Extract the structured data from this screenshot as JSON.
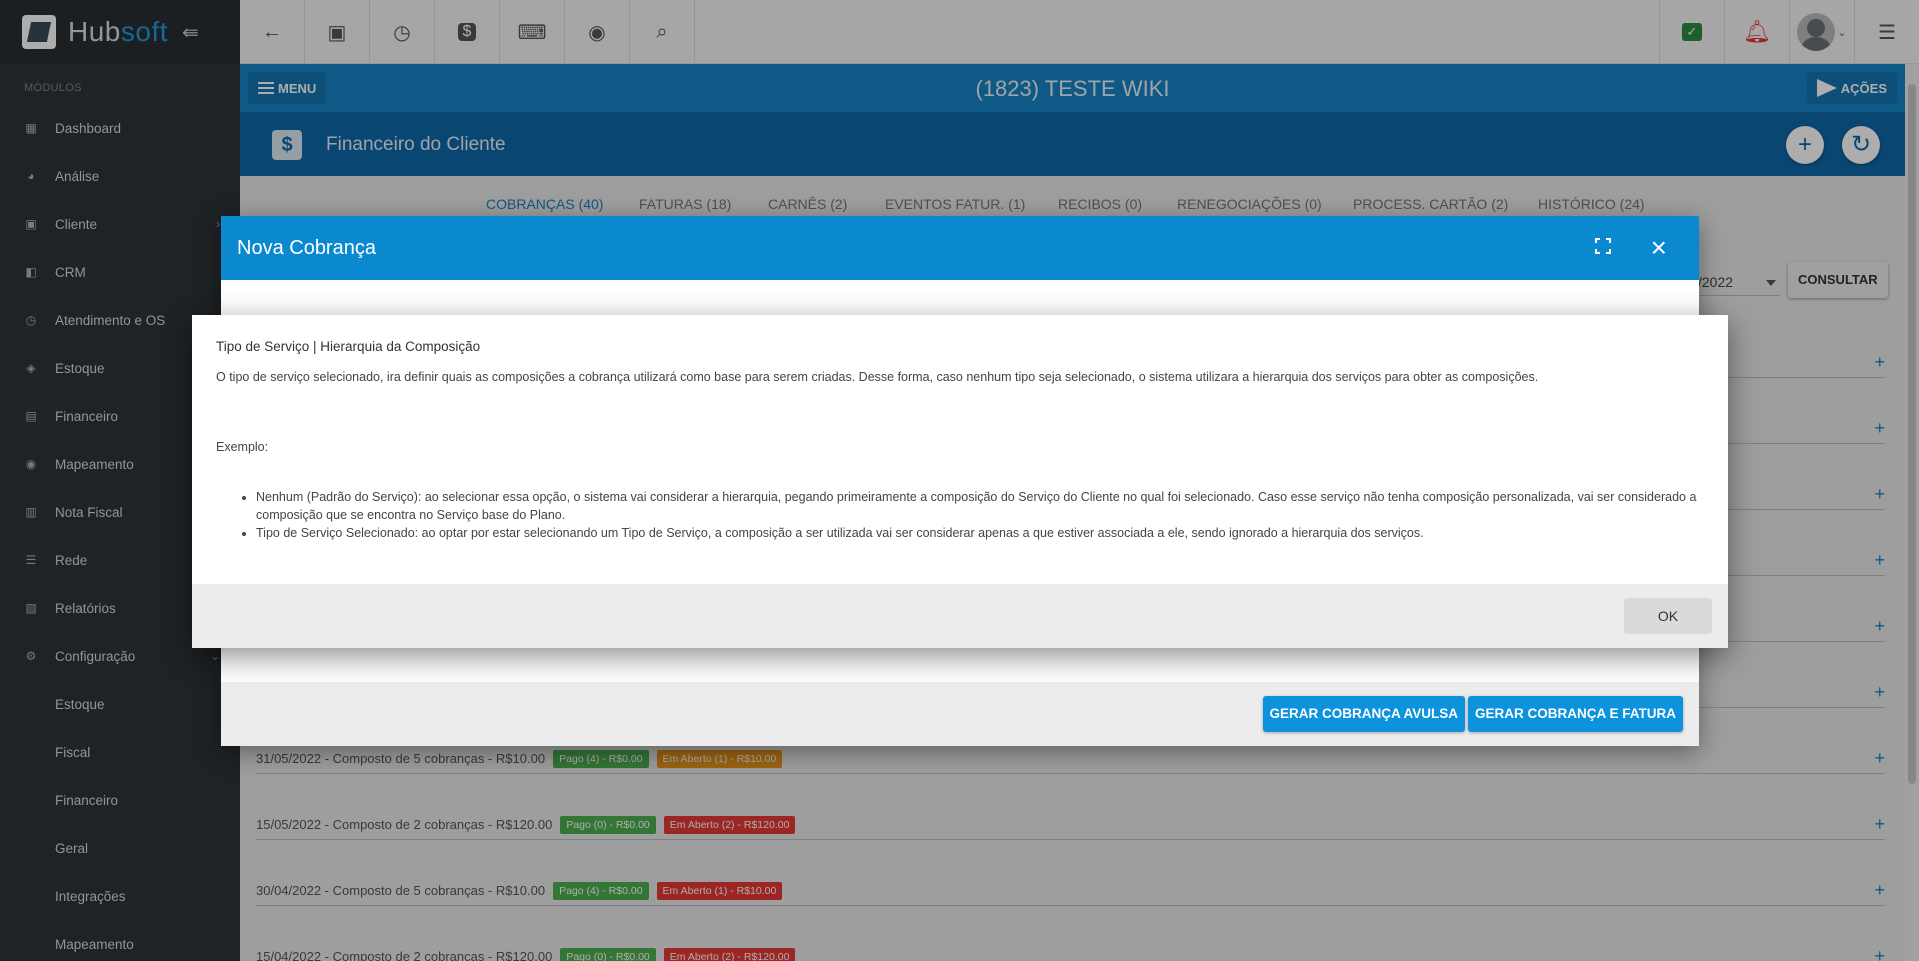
{
  "brand": {
    "name_part1": "Hub",
    "name_part2": "soft"
  },
  "sidebar": {
    "modules_label": "MÓDULOS",
    "items": [
      {
        "label": "Dashboard"
      },
      {
        "label": "Análise"
      },
      {
        "label": "Cliente"
      },
      {
        "label": "CRM"
      },
      {
        "label": "Atendimento e OS"
      },
      {
        "label": "Estoque"
      },
      {
        "label": "Financeiro"
      },
      {
        "label": "Mapeamento"
      },
      {
        "label": "Nota Fiscal"
      },
      {
        "label": "Rede"
      },
      {
        "label": "Relatórios"
      },
      {
        "label": "Configuração"
      }
    ],
    "subitems": [
      {
        "label": "Estoque"
      },
      {
        "label": "Fiscal"
      },
      {
        "label": "Financeiro"
      },
      {
        "label": "Geral"
      },
      {
        "label": "Integrações"
      },
      {
        "label": "Mapeamento"
      }
    ]
  },
  "client_bar": {
    "menu_label": "MENU",
    "title": "(1823) TESTE WIKI",
    "actions_label": "AÇÕES"
  },
  "section": {
    "title": "Financeiro do Cliente",
    "icon": "$"
  },
  "tabs": [
    {
      "label": "COBRANÇAS (40)"
    },
    {
      "label": "FATURAS (18)"
    },
    {
      "label": "CARNÊS (2)"
    },
    {
      "label": "EVENTOS FATUR. (1)"
    },
    {
      "label": "RECIBOS (0)"
    },
    {
      "label": "RENEGOCIAÇÕES (0)"
    },
    {
      "label": "PROCESS. CARTÃO (2)"
    },
    {
      "label": "HISTÓRICO (24)"
    }
  ],
  "filters": {
    "date_value": "/2022",
    "consult_label": "CONSULTAR"
  },
  "rows": [
    {
      "text": "31/05/2022 - Composto de 5 cobranças - R$10.00",
      "paid": "Pago (4) - R$0.00",
      "open": "Em Aberto (1) - R$10.00"
    },
    {
      "text": "15/05/2022 - Composto de 2 cobranças - R$120.00",
      "paid": "Pago (0) - R$0.00",
      "open": "Em Aberto (2) - R$120.00"
    },
    {
      "text": "30/04/2022 - Composto de 5 cobranças - R$10.00",
      "paid": "Pago (4) - R$0.00",
      "open": "Em Aberto (1) - R$10.00"
    },
    {
      "text": "15/04/2022 - Composto de 2 cobranças - R$120.00",
      "paid": "Pago (0) - R$0.00",
      "open": "Em Aberto (2) - R$120.00"
    }
  ],
  "dialog": {
    "title": "Nova Cobrança",
    "btn_avulsa": "GERAR COBRANÇA AVULSA",
    "btn_fatura": "GERAR COBRANÇA E FATURA"
  },
  "info": {
    "title": "Tipo de Serviço | Hierarquia da Composição",
    "description": "O tipo de serviço selecionado, ira definir quais as composições a cobrança utilizará como base para serem criadas. Desse forma, caso nenhum tipo seja selecionado, o sistema utilizara a hierarquia dos serviços para obter as composições.",
    "example_label": "Exemplo:",
    "bullets": [
      "Nenhum (Padrão do Serviço): ao selecionar essa opção, o sistema vai considerar a hierarquia, pegando primeiramente a composição do Serviço do Cliente no qual foi selecionado. Caso esse serviço não tenha composição personalizada, vai ser considerado a composição que se encontra no Serviço base do Plano.",
      "Tipo de Serviço Selecionado: ao optar por estar selecionando um Tipo de Serviço, a composição a ser utilizada vai ser considerar apenas a que estiver associada a ele, sendo ignorado a hierarquia dos serviços."
    ],
    "ok_label": "OK"
  },
  "colors": {
    "primary": "#0a88d0",
    "header": "#1683c6",
    "section": "#1067a8",
    "sidebar": "#2f3338",
    "paid": "#4caf50",
    "open_orange": "#e8941a",
    "open_red": "#e53935"
  }
}
